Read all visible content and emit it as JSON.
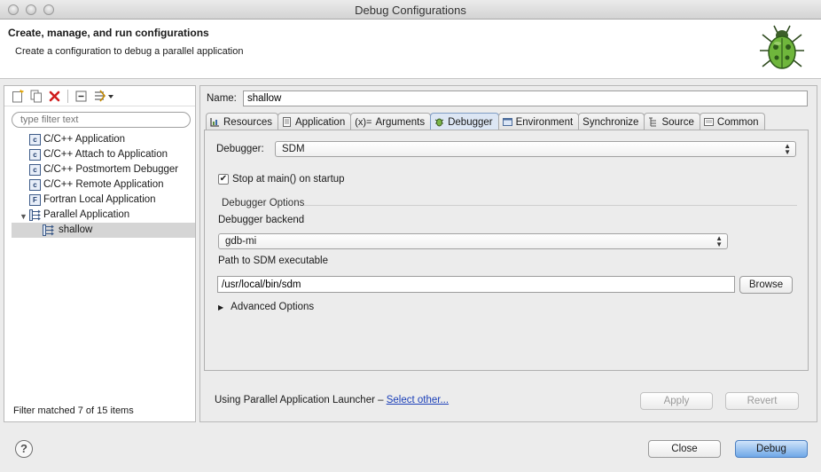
{
  "window": {
    "title": "Debug Configurations"
  },
  "header": {
    "title": "Create, manage, and run configurations",
    "subtitle": "Create a configuration to debug a parallel application"
  },
  "left": {
    "filter_placeholder": "type filter text",
    "tree": [
      {
        "label": "C/C++ Application",
        "icon": "c-app-icon"
      },
      {
        "label": "C/C++ Attach to Application",
        "icon": "c-app-icon"
      },
      {
        "label": "C/C++ Postmortem Debugger",
        "icon": "c-app-icon"
      },
      {
        "label": "C/C++ Remote Application",
        "icon": "c-app-icon"
      },
      {
        "label": "Fortran Local Application",
        "icon": "fortran-app-icon"
      },
      {
        "label": "Parallel Application",
        "icon": "parallel-app-icon",
        "expanded": true
      },
      {
        "label": "shallow",
        "icon": "parallel-app-icon",
        "selected": true
      }
    ],
    "status": "Filter matched 7 of 15 items"
  },
  "config": {
    "name_label": "Name:",
    "name_value": "shallow",
    "tabs": [
      {
        "label": "Resources",
        "icon": "resources-icon"
      },
      {
        "label": "Application",
        "icon": "application-icon"
      },
      {
        "label": "Arguments",
        "icon": "arguments-icon",
        "icon_text": "(x)="
      },
      {
        "label": "Debugger",
        "icon": "debugger-icon",
        "active": true
      },
      {
        "label": "Environment",
        "icon": "environment-icon"
      },
      {
        "label": "Synchronize",
        "icon": ""
      },
      {
        "label": "Source",
        "icon": "source-icon"
      },
      {
        "label": "Common",
        "icon": "common-icon"
      }
    ],
    "debugger": {
      "label": "Debugger:",
      "value": "SDM",
      "stop_at_main_label": "Stop at main() on startup",
      "stop_at_main_checked": true,
      "options_group": "Debugger Options",
      "backend_label": "Debugger backend",
      "backend_value": "gdb-mi",
      "path_label": "Path to SDM executable",
      "path_value": "/usr/local/bin/sdm",
      "browse": "Browse",
      "advanced": "Advanced Options"
    },
    "launcher_text": "Using Parallel Application Launcher –",
    "launcher_link": "Select other...",
    "apply": "Apply",
    "revert": "Revert"
  },
  "footer": {
    "help": "?",
    "close": "Close",
    "debug": "Debug"
  },
  "colors": {
    "accent": "#4b7fc1",
    "selection": "#d5d5d5",
    "link": "#1a3fb8"
  }
}
